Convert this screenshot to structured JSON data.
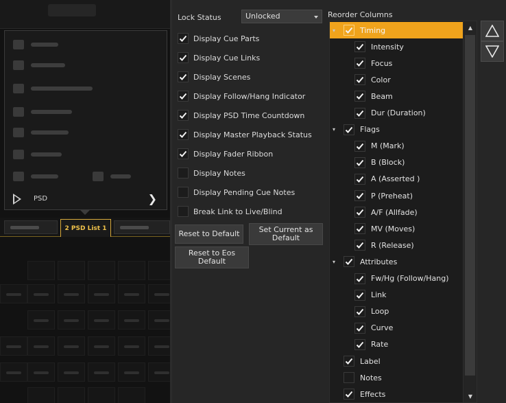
{
  "lock_status": {
    "label": "Lock Status",
    "value": "Unlocked"
  },
  "options": [
    {
      "label": "Display Cue Parts",
      "checked": true
    },
    {
      "label": "Display Cue Links",
      "checked": true
    },
    {
      "label": "Display Scenes",
      "checked": true
    },
    {
      "label": "Display Follow/Hang Indicator",
      "checked": true
    },
    {
      "label": "Display PSD Time Countdown",
      "checked": true
    },
    {
      "label": "Display Master Playback Status",
      "checked": true
    },
    {
      "label": "Display Fader Ribbon",
      "checked": true
    },
    {
      "label": "Display Notes",
      "checked": false
    },
    {
      "label": "Display Pending Cue Notes",
      "checked": false
    },
    {
      "label": "Break Link to Live/Blind",
      "checked": false
    }
  ],
  "buttons": {
    "reset_default": "Reset to Default",
    "set_current_default": "Set Current as Default",
    "reset_eos_default": "Reset to Eos Default"
  },
  "reorder": {
    "label": "Reorder Columns",
    "items": [
      {
        "label": "Timing",
        "checked": true,
        "level": 0,
        "expandable": true,
        "selected": true
      },
      {
        "label": "Intensity",
        "checked": true,
        "level": 1
      },
      {
        "label": "Focus",
        "checked": true,
        "level": 1
      },
      {
        "label": "Color",
        "checked": true,
        "level": 1
      },
      {
        "label": "Beam",
        "checked": true,
        "level": 1
      },
      {
        "label": "Dur (Duration)",
        "checked": true,
        "level": 1
      },
      {
        "label": "Flags",
        "checked": true,
        "level": 0,
        "expandable": true
      },
      {
        "label": "M (Mark)",
        "checked": true,
        "level": 1
      },
      {
        "label": "B (Block)",
        "checked": true,
        "level": 1
      },
      {
        "label": "A (Asserted )",
        "checked": true,
        "level": 1
      },
      {
        "label": "P (Preheat)",
        "checked": true,
        "level": 1
      },
      {
        "label": "A/F (Allfade)",
        "checked": true,
        "level": 1
      },
      {
        "label": "MV (Moves)",
        "checked": true,
        "level": 1
      },
      {
        "label": "R (Release)",
        "checked": true,
        "level": 1
      },
      {
        "label": "Attributes",
        "checked": true,
        "level": 0,
        "expandable": true
      },
      {
        "label": "Fw/Hg (Follow/Hang)",
        "checked": true,
        "level": 1
      },
      {
        "label": "Link",
        "checked": true,
        "level": 1
      },
      {
        "label": "Loop",
        "checked": true,
        "level": 1
      },
      {
        "label": "Curve",
        "checked": true,
        "level": 1
      },
      {
        "label": "Rate",
        "checked": true,
        "level": 1
      },
      {
        "label": "Label",
        "checked": true,
        "level": 0
      },
      {
        "label": "Notes",
        "checked": false,
        "level": 0
      },
      {
        "label": "Effects",
        "checked": true,
        "level": 0
      }
    ]
  },
  "left": {
    "menu_bottom_item": "PSD",
    "active_tab": "2 PSD List 1"
  },
  "colors": {
    "accent": "#f0a31c",
    "tab_accent": "#f0c24a",
    "panel_bg": "#262626"
  }
}
